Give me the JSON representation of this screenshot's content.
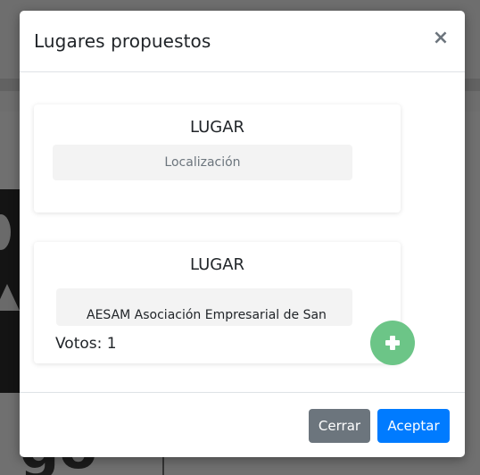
{
  "modal": {
    "title": "Lugares propuestos",
    "close_label": "×"
  },
  "places": [
    {
      "title": "LUGAR",
      "location_placeholder": "Localización",
      "location_value": ""
    },
    {
      "title": "LUGAR",
      "location_value": "AESAM Asociación Empresarial de San",
      "votes_label": "Votos: 1"
    }
  ],
  "add_button_icon": "plus-icon",
  "footer": {
    "close_label": "Cerrar",
    "accept_label": "Aceptar"
  },
  "background": {
    "partial_word": "go"
  },
  "colors": {
    "primary": "#007bff",
    "secondary": "#6c757d",
    "success": "#6cc587"
  }
}
